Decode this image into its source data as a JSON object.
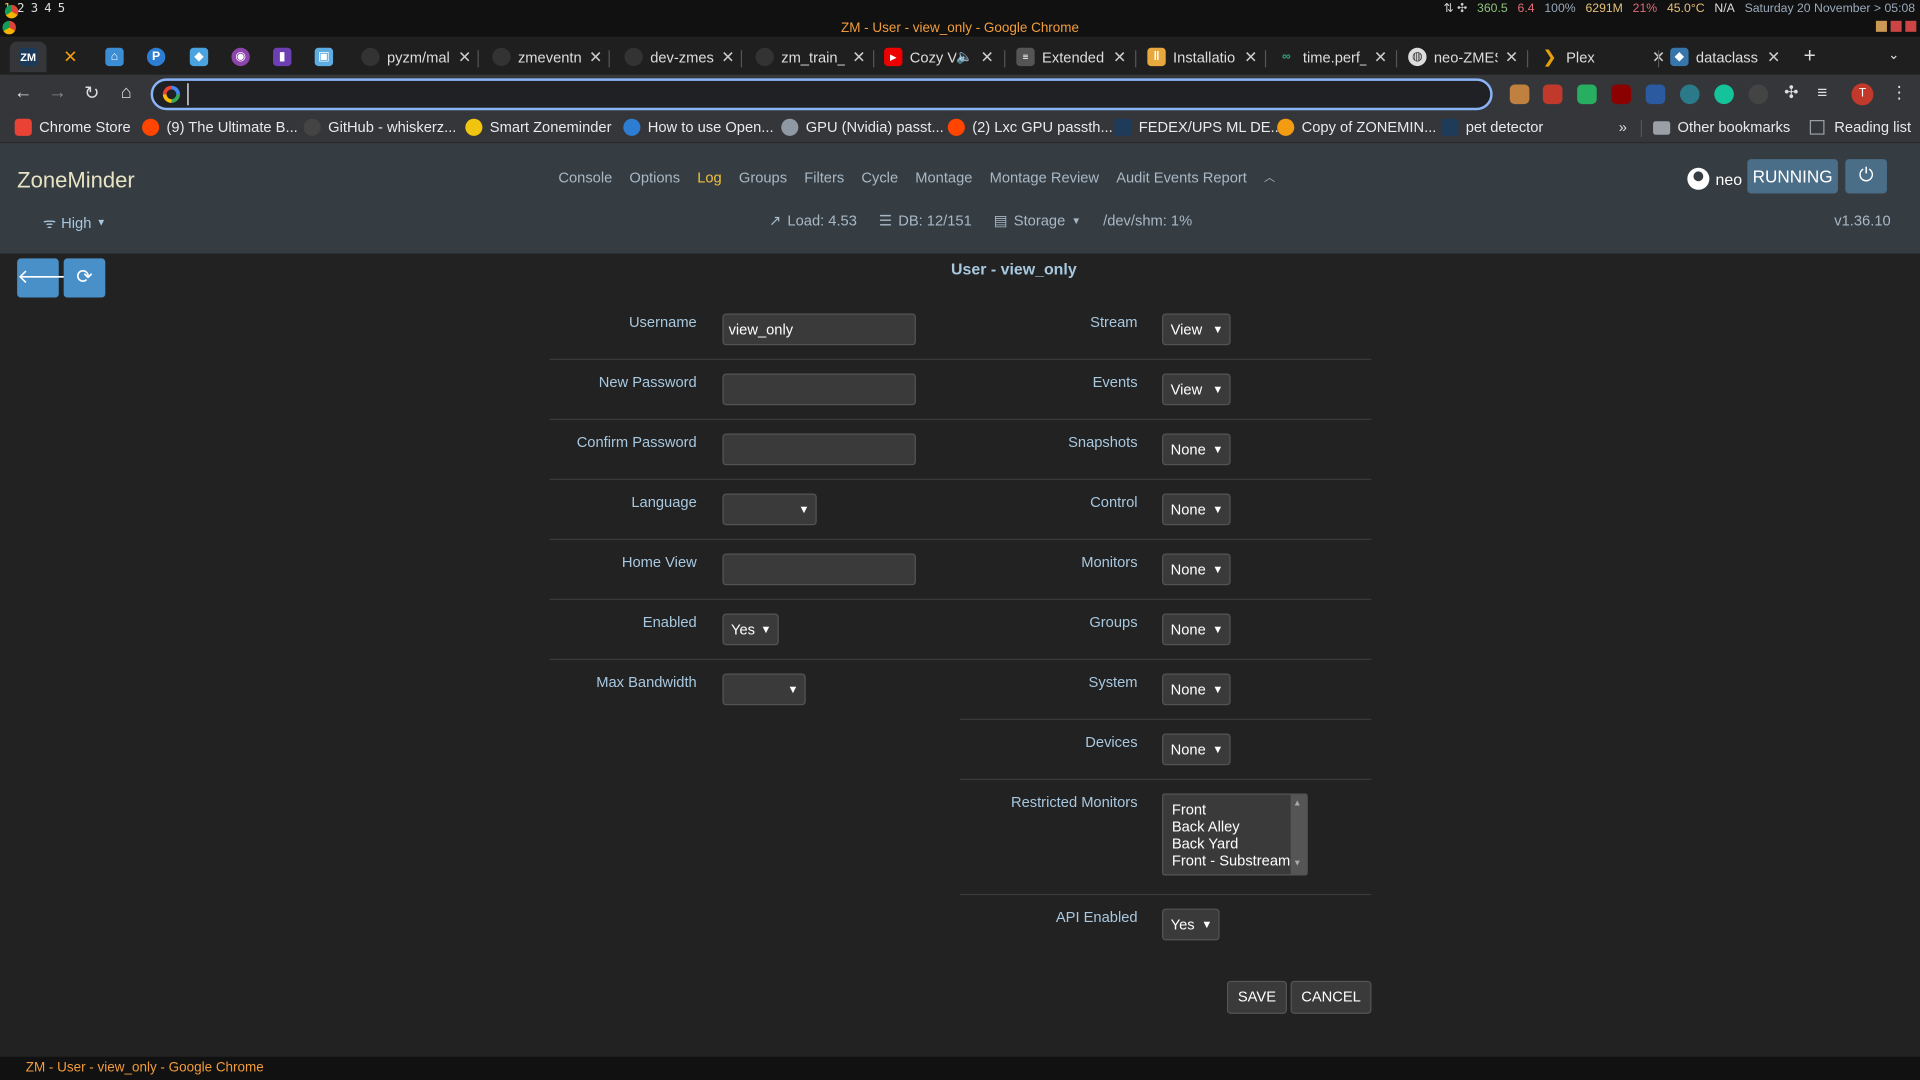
{
  "os": {
    "workspaces": [
      "1",
      "2",
      "3",
      "4",
      "5"
    ],
    "stats": {
      "net": "360.5",
      "up": "6.4",
      "volume": "100%",
      "mem": "6291M",
      "cpu": "21%",
      "temp": "45.0°C",
      "battery": "N/A",
      "datetime": "Saturday 20 November > 05:08"
    }
  },
  "window_title": "ZM - User - view_only - Google Chrome",
  "tabs": [
    {
      "title": "",
      "icon": "zm-icon"
    },
    {
      "title": "",
      "icon": "x-icon"
    },
    {
      "title": "",
      "icon": "home-assistant-icon"
    },
    {
      "title": "",
      "icon": "pycharm-icon"
    },
    {
      "title": "",
      "icon": "box-icon"
    },
    {
      "title": "",
      "icon": "shield-icon"
    },
    {
      "title": "",
      "icon": "tor-icon"
    },
    {
      "title": "",
      "icon": "screen-icon"
    },
    {
      "title": "pyzm/mal",
      "icon": "github-icon"
    },
    {
      "title": "zmeventn",
      "icon": "github-icon"
    },
    {
      "title": "dev-zmes/",
      "icon": "github-icon"
    },
    {
      "title": "zm_train_",
      "icon": "github-icon"
    },
    {
      "title": "Cozy V",
      "icon": "youtube-icon"
    },
    {
      "title": "Extended",
      "icon": "extension-icon"
    },
    {
      "title": "Installatio",
      "icon": "docs-icon"
    },
    {
      "title": "time.perf_",
      "icon": "python-icon"
    },
    {
      "title": "neo-ZMES",
      "icon": "globe-icon"
    },
    {
      "title": "Plex",
      "icon": "plex-icon"
    },
    {
      "title": "dataclass",
      "icon": "python-icon"
    }
  ],
  "omnibox": {
    "value": ""
  },
  "bookmarks": [
    "Chrome Store",
    "(9) The Ultimate B...",
    "GitHub - whiskerz...",
    "Smart Zoneminder",
    "How to use Open...",
    "GPU (Nvidia) passt...",
    "(2) Lxc GPU passth...",
    "FEDEX/UPS ML DE...",
    "Copy of ZONEMIN...",
    "pet detector"
  ],
  "bookmarks_more": "»",
  "other_bookmarks": "Other bookmarks",
  "reading_list": "Reading list",
  "zm": {
    "logo": "ZoneMinder",
    "nav": [
      "Console",
      "Options",
      "Log",
      "Groups",
      "Filters",
      "Cycle",
      "Montage",
      "Montage Review",
      "Audit Events Report"
    ],
    "nav_active": "Log",
    "user": "neo",
    "state": "RUNNING",
    "bandwidth": "High",
    "load": "Load: 4.53",
    "db": "DB: 12/151",
    "storage": "Storage",
    "shm": "/dev/shm: 1%",
    "version": "v1.36.10"
  },
  "page_title": "User - view_only",
  "form": {
    "left": {
      "username_label": "Username",
      "username_value": "view_only",
      "new_password_label": "New Password",
      "confirm_password_label": "Confirm Password",
      "language_label": "Language",
      "language_value": "",
      "home_view_label": "Home View",
      "home_view_value": "",
      "enabled_label": "Enabled",
      "enabled_value": "Yes",
      "max_bandwidth_label": "Max Bandwidth",
      "max_bandwidth_value": ""
    },
    "right": {
      "stream_label": "Stream",
      "stream_value": "View",
      "events_label": "Events",
      "events_value": "View",
      "snapshots_label": "Snapshots",
      "snapshots_value": "None",
      "control_label": "Control",
      "control_value": "None",
      "monitors_label": "Monitors",
      "monitors_value": "None",
      "groups_label": "Groups",
      "groups_value": "None",
      "system_label": "System",
      "system_value": "None",
      "devices_label": "Devices",
      "devices_value": "None",
      "restricted_label": "Restricted Monitors",
      "restricted_options": [
        "Front",
        "Back Alley",
        "Back Yard",
        "Front - Substream"
      ],
      "api_label": "API Enabled",
      "api_value": "Yes"
    },
    "save": "SAVE",
    "cancel": "CANCEL"
  },
  "taskbar_title": "ZM - User - view_only - Google Chrome"
}
